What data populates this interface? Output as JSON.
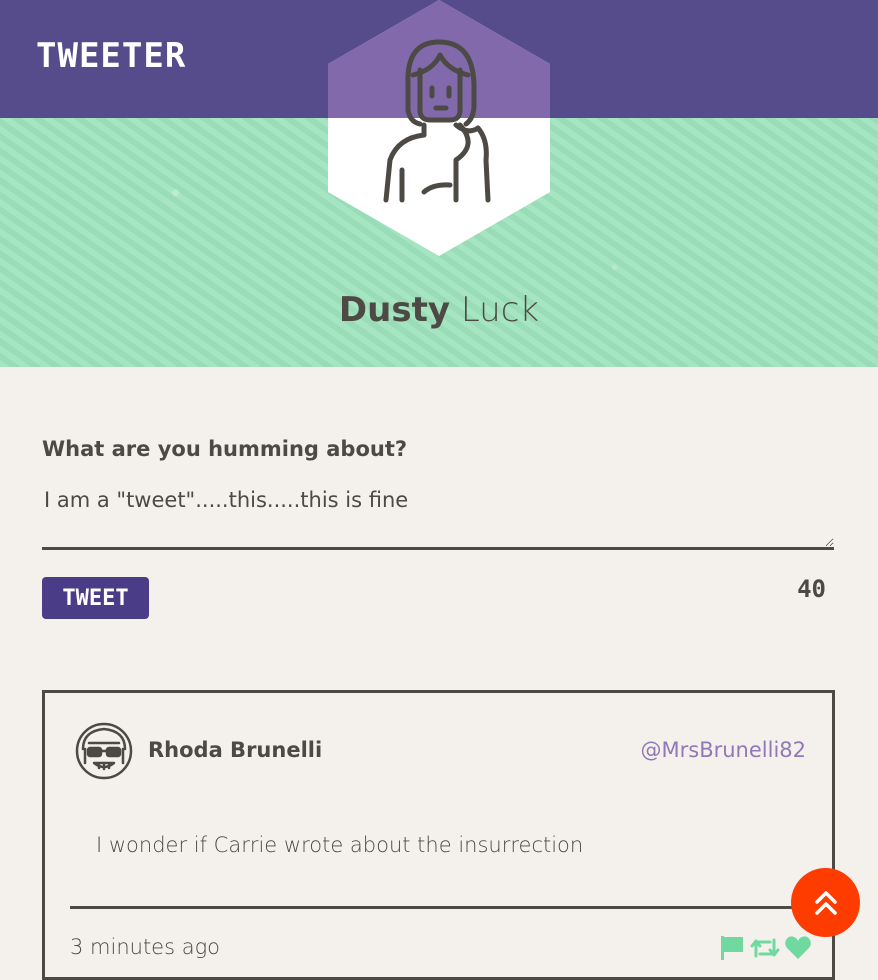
{
  "nav": {
    "brand": "TWEETER"
  },
  "profile": {
    "first_name": "Dusty",
    "last_name": "Luck",
    "avatar_icon": "woman-avatar-icon"
  },
  "composer": {
    "label": "What are you humming about?",
    "value": "I am a \"tweet\".....this.....this is fine",
    "button_label": "TWEET",
    "char_count": "40"
  },
  "tweets": [
    {
      "author": "Rhoda Brunelli",
      "handle": "@MrsBrunelli82",
      "text": "I wonder if Carrie wrote about the insurrection",
      "time": "3 minutes ago",
      "avatar_icon": "sunglasses-avatar-icon",
      "actions": [
        "flag-icon",
        "retweet-icon",
        "heart-icon"
      ]
    }
  ],
  "colors": {
    "nav": "#574c8b",
    "hero": "#9fe3bd",
    "button": "#4b3c87",
    "handle": "#8f79b6",
    "action_green": "#6fd9a0",
    "scroll_button": "#ff3c00",
    "background": "#f4f1ec"
  },
  "scroll_top": {
    "icon": "double-chevron-up-icon"
  }
}
